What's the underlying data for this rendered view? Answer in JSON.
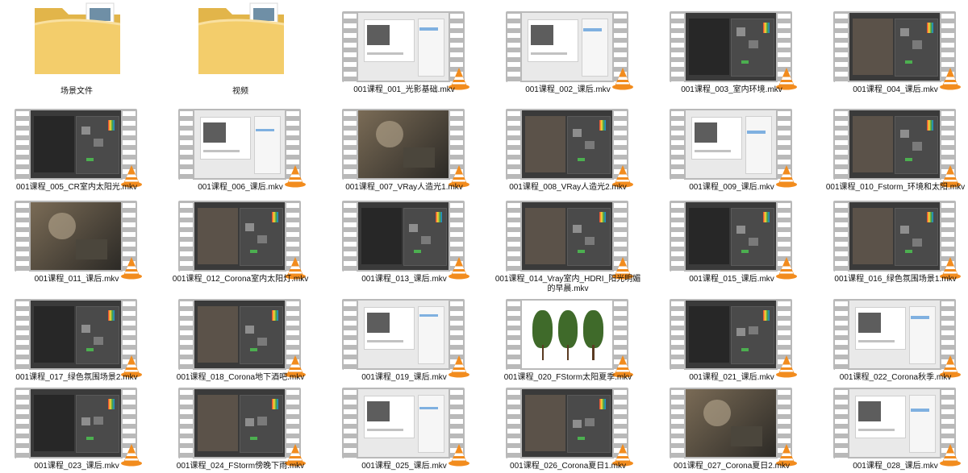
{
  "files": [
    {
      "name": "场景文件",
      "kind": "folder"
    },
    {
      "name": "视频",
      "kind": "folder"
    },
    {
      "name": "001课程_001_光影基础.mkv",
      "kind": "video",
      "theme": "light"
    },
    {
      "name": "001课程_002_课后.mkv",
      "kind": "video",
      "theme": "light"
    },
    {
      "name": "001课程_003_室内环境.mkv",
      "kind": "video",
      "theme": "dark"
    },
    {
      "name": "001课程_004_课后.mkv",
      "kind": "video",
      "theme": "dark"
    },
    {
      "name": "001课程_005_CR室内太阳光.mkv",
      "kind": "video",
      "theme": "dark"
    },
    {
      "name": "001课程_006_课后.mkv",
      "kind": "video",
      "theme": "light"
    },
    {
      "name": "001课程_007_VRay人造光1.mkv",
      "kind": "video",
      "theme": "render"
    },
    {
      "name": "001课程_008_VRay人造光2.mkv",
      "kind": "video",
      "theme": "dark"
    },
    {
      "name": "001课程_009_课后.mkv",
      "kind": "video",
      "theme": "light"
    },
    {
      "name": "001课程_010_Fstorm_环境和太阳.mkv",
      "kind": "video",
      "theme": "dark"
    },
    {
      "name": "001课程_011_课后.mkv",
      "kind": "video",
      "theme": "render"
    },
    {
      "name": "001课程_012_Corona室内太阳灯.mkv",
      "kind": "video",
      "theme": "dark"
    },
    {
      "name": "001课程_013_课后.mkv",
      "kind": "video",
      "theme": "dark"
    },
    {
      "name": "001课程_014_Vray室内_HDRI_阳光明媚的早晨.mkv",
      "kind": "video",
      "theme": "dark"
    },
    {
      "name": "001课程_015_课后.mkv",
      "kind": "video",
      "theme": "dark"
    },
    {
      "name": "001课程_016_绿色氛围场景1.mkv",
      "kind": "video",
      "theme": "dark"
    },
    {
      "name": "001课程_017_绿色氛围场景2.mkv",
      "kind": "video",
      "theme": "dark"
    },
    {
      "name": "001课程_018_Corona地下酒吧.mkv",
      "kind": "video",
      "theme": "dark"
    },
    {
      "name": "001课程_019_课后.mkv",
      "kind": "video",
      "theme": "light"
    },
    {
      "name": "001课程_020_FStorm太阳夏季.mkv",
      "kind": "video",
      "theme": "trees"
    },
    {
      "name": "001课程_021_课后.mkv",
      "kind": "video",
      "theme": "dark"
    },
    {
      "name": "001课程_022_Corona秋季.mkv",
      "kind": "video",
      "theme": "light"
    },
    {
      "name": "001课程_023_课后.mkv",
      "kind": "video",
      "theme": "dark"
    },
    {
      "name": "001课程_024_FStorm傍晚下雨.mkv",
      "kind": "video",
      "theme": "dark"
    },
    {
      "name": "001课程_025_课后.mkv",
      "kind": "video",
      "theme": "light"
    },
    {
      "name": "001课程_026_Corona夏日1.mkv",
      "kind": "video",
      "theme": "dark"
    },
    {
      "name": "001课程_027_Corona夏日2.mkv",
      "kind": "video",
      "theme": "render"
    },
    {
      "name": "001课程_028_课后.mkv",
      "kind": "video",
      "theme": "light"
    }
  ],
  "colors": {
    "folder": "#f3cd6b",
    "folder_dark": "#e2b54a",
    "film": "#b9b9b9",
    "cone": "#f28c1e",
    "cone_stripe": "#ffffff"
  },
  "icons": {
    "folder": "folder-icon",
    "film": "film-strip-icon",
    "player": "vlc-cone-icon"
  }
}
